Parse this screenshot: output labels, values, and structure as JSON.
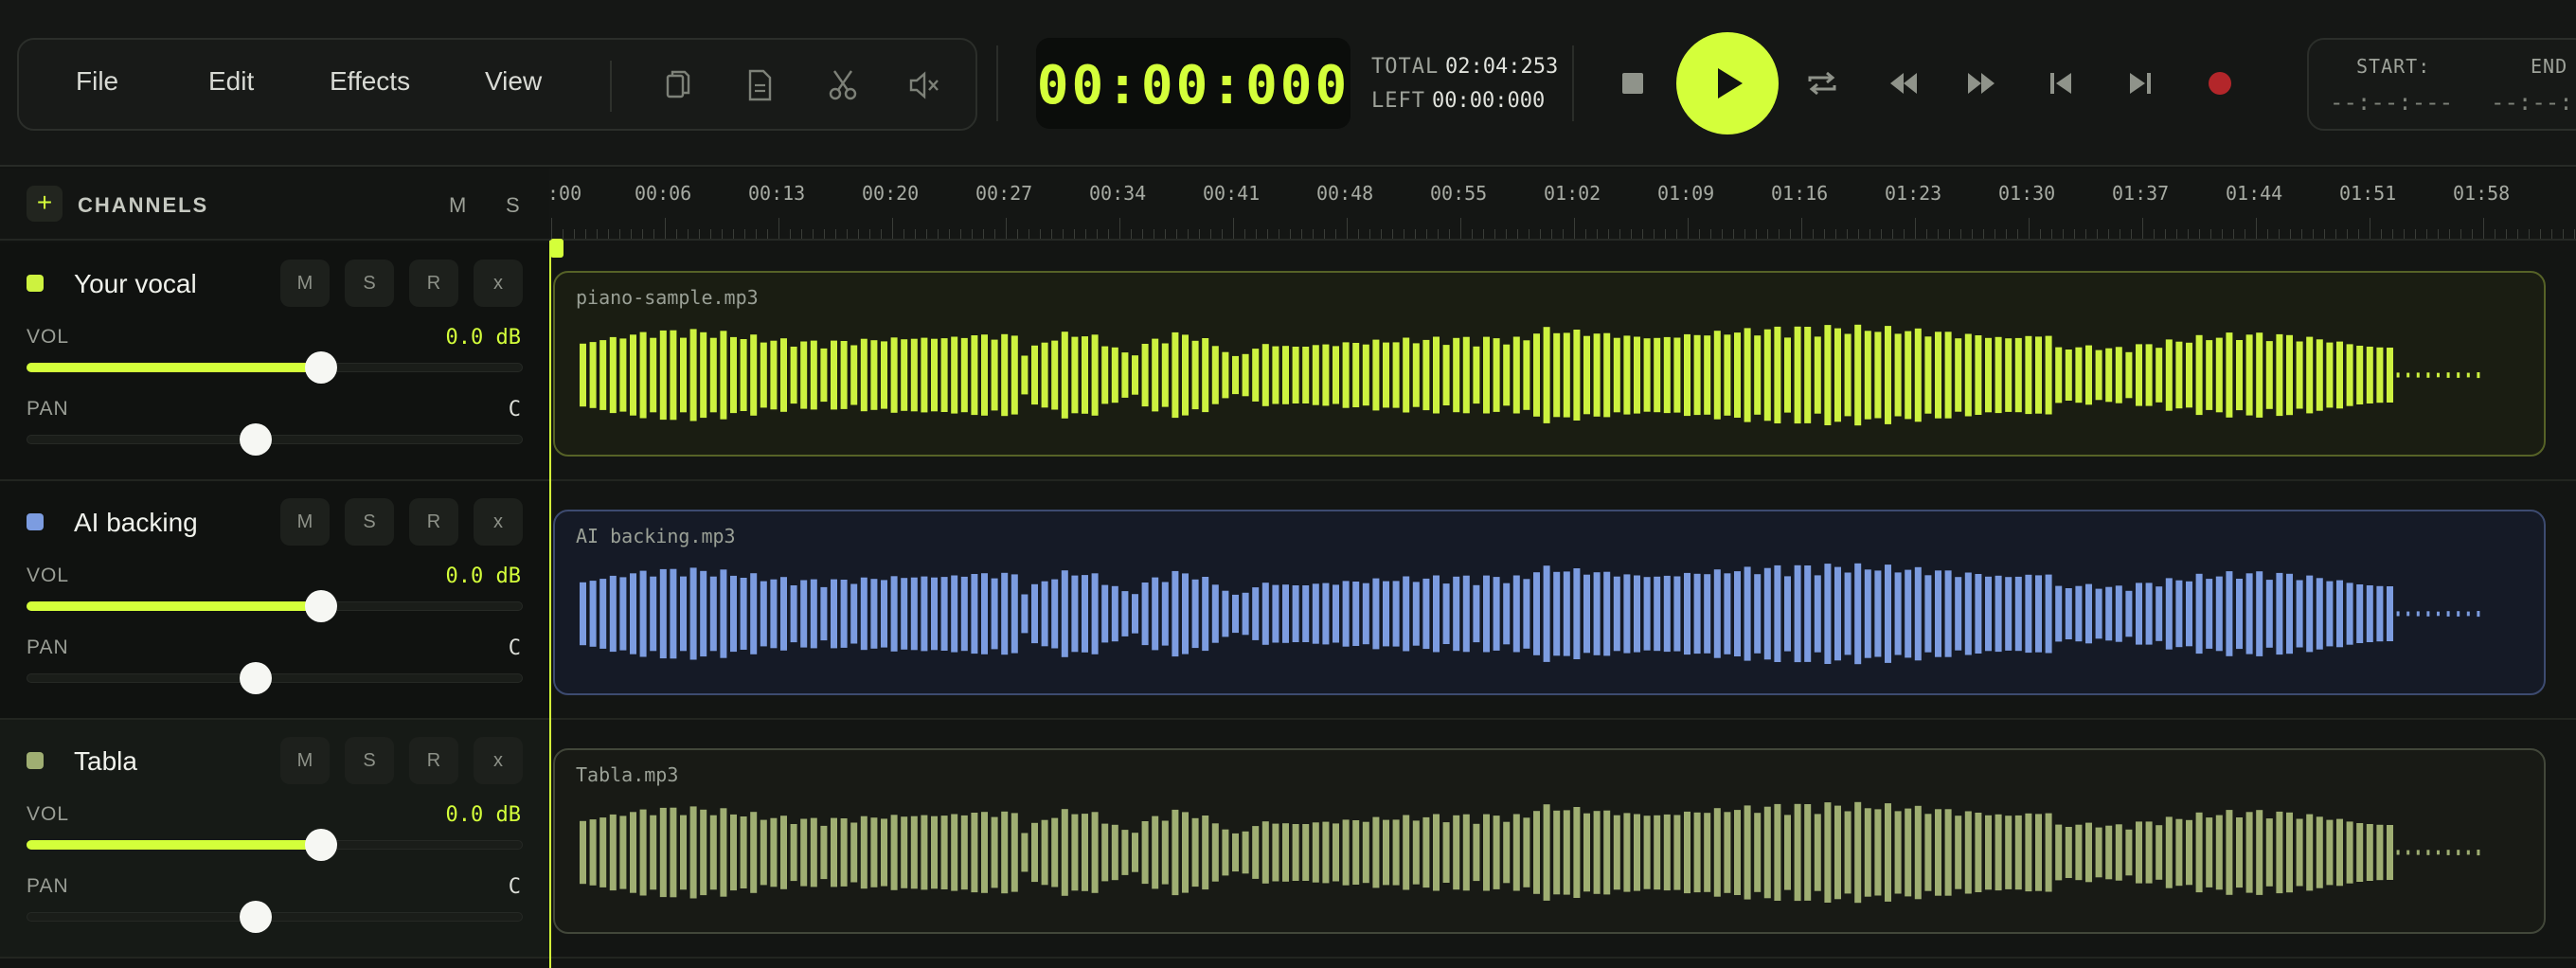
{
  "colors": {
    "accent": "#d4ff3a",
    "vocal": "#cdf23f",
    "backing": "#7c9ce0",
    "tabla": "#9fae72"
  },
  "menu": {
    "file": "File",
    "edit": "Edit",
    "effects": "Effects",
    "view": "View",
    "icons": [
      "copy-icon",
      "document-icon",
      "scissors-icon",
      "mute-icon"
    ]
  },
  "counter": {
    "time": "00:00:000"
  },
  "stats": {
    "total_label": "TOTAL",
    "total_value": "02:04:253",
    "left_label": "LEFT",
    "left_value": "00:00:000"
  },
  "transport": {
    "icons": [
      "stop-icon",
      "play-icon",
      "loop-icon",
      "rewind-icon",
      "fast-forward-icon",
      "skip-start-icon",
      "skip-end-icon",
      "record-icon"
    ]
  },
  "range": {
    "start_label": "START:",
    "start_value": "--:--:---",
    "end_label": "END",
    "end_value": "--:--:"
  },
  "channels_header": {
    "add": "+",
    "title": "CHANNELS",
    "mute": "M",
    "solo": "S"
  },
  "channels": [
    {
      "name": "Your vocal",
      "color": "#cdf23f",
      "buttons": [
        "M",
        "S",
        "R",
        "x"
      ],
      "vol_label": "VOL",
      "vol_value": "0.0 dB",
      "vol_level": 0.594,
      "pan_label": "PAN",
      "pan_value": "C",
      "pan_level": 0.5
    },
    {
      "name": "AI backing",
      "color": "#7c9ce0",
      "buttons": [
        "M",
        "S",
        "R",
        "x"
      ],
      "vol_label": "VOL",
      "vol_value": "0.0 dB",
      "vol_level": 0.594,
      "pan_label": "PAN",
      "pan_value": "C",
      "pan_level": 0.5
    },
    {
      "name": "Tabla",
      "color": "#9fae72",
      "buttons": [
        "M",
        "S",
        "R",
        "x"
      ],
      "vol_label": "VOL",
      "vol_value": "0.0 dB",
      "vol_level": 0.594,
      "pan_label": "PAN",
      "pan_value": "C",
      "pan_level": 0.5
    }
  ],
  "ruler": {
    "ticks": [
      ":00",
      "00:06",
      "00:13",
      "00:20",
      "00:27",
      "00:34",
      "00:41",
      "00:48",
      "00:55",
      "01:02",
      "01:09",
      "01:16",
      "01:23",
      "01:30",
      "01:37",
      "01:44",
      "01:51",
      "01:58"
    ]
  },
  "clips": [
    {
      "name": "piano-sample.mp3",
      "color": "#cdf23f",
      "bg": "#1a1d12",
      "border": "#566227"
    },
    {
      "name": "AI backing.mp3",
      "color": "#7c9ce0",
      "bg": "#151a26",
      "border": "#3d4b70"
    },
    {
      "name": "Tabla.mp3",
      "color": "#9fae72",
      "bg": "#181a15",
      "border": "#42473a"
    }
  ]
}
